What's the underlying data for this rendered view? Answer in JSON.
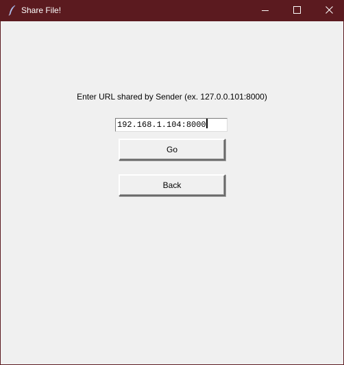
{
  "window": {
    "title": "Share File!",
    "app_icon": "feather-icon",
    "controls": {
      "minimize_icon": "minimize-icon",
      "maximize_icon": "maximize-icon",
      "close_icon": "close-icon"
    },
    "titlebar_color": "#5b1a1f"
  },
  "main": {
    "prompt": "Enter URL shared by Sender (ex. 127.0.0.101:8000)",
    "url_input": {
      "value": "192.168.1.104:8000"
    },
    "go_button": "Go",
    "back_button": "Back"
  }
}
